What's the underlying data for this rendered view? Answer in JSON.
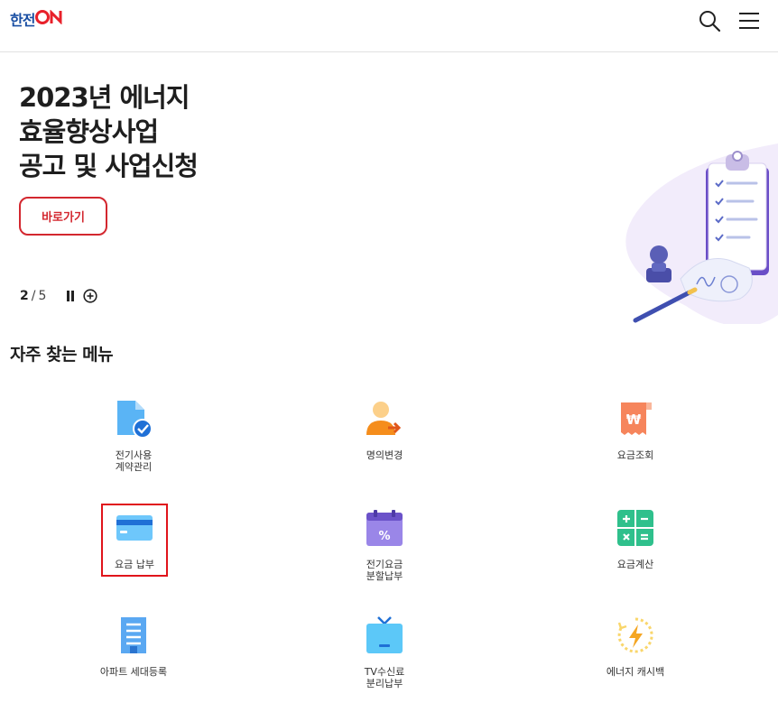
{
  "header": {
    "logo_k": "한전",
    "logo_on": "ON",
    "search_label": "검색",
    "menu_label": "전체메뉴"
  },
  "banner": {
    "title": "2023년 에너지\n효율향상사업\n공고 및 사업신청",
    "button_label": "바로가기",
    "pager": {
      "current": "2",
      "separator": "/",
      "total": "5"
    }
  },
  "quick_menu": {
    "title": "자주 찾는 메뉴",
    "items": [
      {
        "label": "전기사용\n계약관리",
        "icon": "document-check-icon"
      },
      {
        "label": "명의변경",
        "icon": "person-transfer-icon"
      },
      {
        "label": "요금조회",
        "icon": "bill-won-icon"
      },
      {
        "label": "요금 납부",
        "icon": "credit-card-icon"
      },
      {
        "label": "전기요금\n분할납부",
        "icon": "calendar-percent-icon"
      },
      {
        "label": "요금계산",
        "icon": "calculator-icon"
      },
      {
        "label": "아파트 세대등록",
        "icon": "apartment-icon"
      },
      {
        "label": "TV수신료\n분리납부",
        "icon": "tv-icon"
      },
      {
        "label": "에너지 캐시백",
        "icon": "energy-cashback-icon"
      }
    ]
  },
  "colors": {
    "accent_red": "#d3272f",
    "brand_blue": "#1a4fa3",
    "selected_outline": "#e0141b"
  }
}
